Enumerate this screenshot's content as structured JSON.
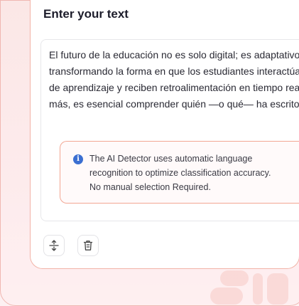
{
  "card": {
    "title": "Enter your text"
  },
  "editor": {
    "lines": [
      "El futuro de la educación no es solo digital; es adaptativo. La IA está",
      "transformando la forma en que los estudiantes interactúan con los materiales",
      "de aprendizaje y reciben retroalimentación en tiempo real. Sin embargo,",
      "más, es esencial comprender quién —o qué— ha escrito un texto."
    ]
  },
  "notice": {
    "icon": "info-icon",
    "lines": [
      "The AI Detector uses automatic language",
      "recognition to optimize classification accuracy.",
      "No manual selection Required."
    ]
  },
  "toolbar": {
    "expand_icon": "expand-vertical-icon",
    "delete_icon": "trash-icon"
  },
  "colors": {
    "accent_border": "#f2b3a7",
    "info_blue": "#3b6fd1",
    "background": "#fbe7e6"
  }
}
